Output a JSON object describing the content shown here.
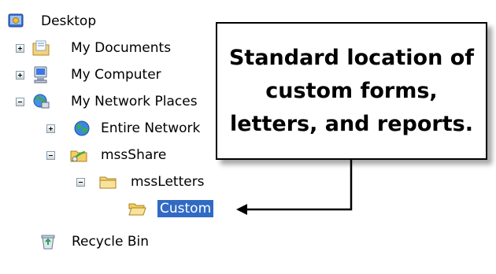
{
  "tree": {
    "items": [
      {
        "label": "Desktop",
        "icon": "desktop-icon",
        "expander": "none"
      },
      {
        "label": "My Documents",
        "icon": "my-documents-icon",
        "expander": "plus"
      },
      {
        "label": "My Computer",
        "icon": "my-computer-icon",
        "expander": "plus"
      },
      {
        "label": "My Network Places",
        "icon": "network-places-icon",
        "expander": "minus"
      },
      {
        "label": "Entire Network",
        "icon": "globe-icon",
        "expander": "plus"
      },
      {
        "label": "mssShare",
        "icon": "shared-folder-icon",
        "expander": "minus"
      },
      {
        "label": "mssLetters",
        "icon": "folder-icon",
        "expander": "minus"
      },
      {
        "label": "Custom",
        "icon": "open-folder-icon",
        "expander": "none",
        "selected": true
      },
      {
        "label": "Recycle Bin",
        "icon": "recycle-bin-icon",
        "expander": "none"
      }
    ]
  },
  "callout": {
    "text": "Standard location of\ncustom forms,\nletters, and reports."
  },
  "colors": {
    "selection": "#316ac5",
    "expander_border": "#7f9db9"
  }
}
